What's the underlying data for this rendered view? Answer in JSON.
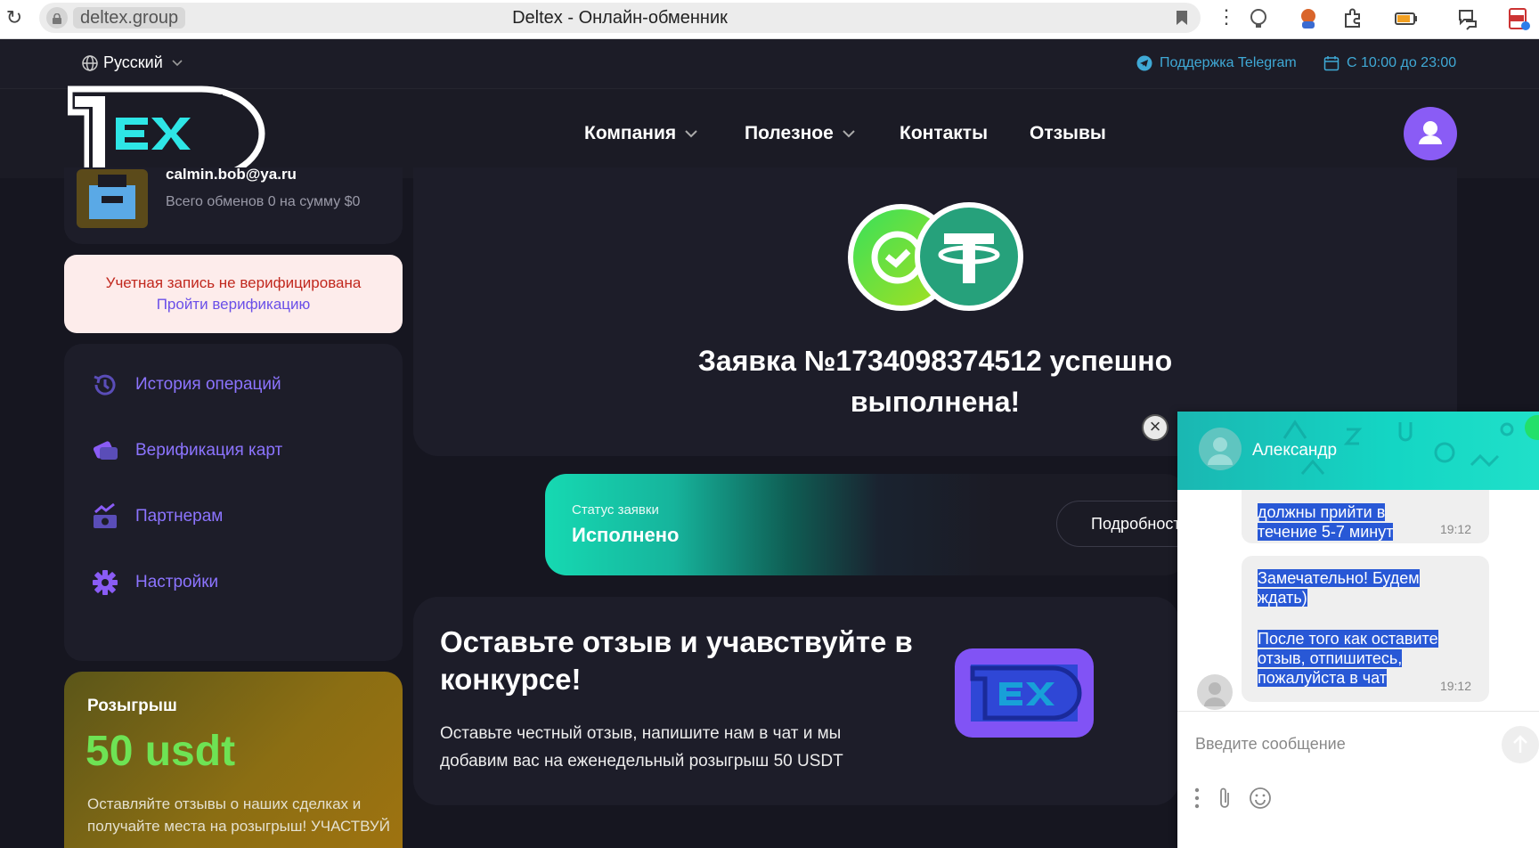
{
  "browser": {
    "url": "deltex.group",
    "tab_title": "Deltex - Онлайн-обменник"
  },
  "topbar": {
    "language": "Русский",
    "support": "Поддержка Telegram",
    "hours": "С 10:00 до 23:00"
  },
  "nav": {
    "items": [
      {
        "label": "Компания",
        "dropdown": true
      },
      {
        "label": "Полезное",
        "dropdown": true
      },
      {
        "label": "Контакты",
        "dropdown": false
      },
      {
        "label": "Отзывы",
        "dropdown": false
      }
    ]
  },
  "user": {
    "email": "calmin.bob@ya.ru",
    "stats": "Всего обменов 0 на сумму $0"
  },
  "verification": {
    "warning": "Учетная запись не верифицирована",
    "link": "Пройти верификацию"
  },
  "sidebar": {
    "items": [
      {
        "label": "История операций",
        "icon": "history-icon"
      },
      {
        "label": "Верификация карт",
        "icon": "card-icon"
      },
      {
        "label": "Партнерам",
        "icon": "partners-icon"
      },
      {
        "label": "Настройки",
        "icon": "gear-icon"
      }
    ]
  },
  "promo": {
    "title": "Розыгрыш",
    "amount": "50 usdt",
    "text": "Оставляйте отзывы о наших сделках и получайте места на розыгрыш! УЧАСТВУЙ"
  },
  "order": {
    "title": "Заявка №1734098374512 успешно выполнена!"
  },
  "status": {
    "label": "Статус заявки",
    "value": "Исполнено",
    "details_button": "Подробности"
  },
  "review": {
    "title": "Оставьте отзыв и учавствуйте в конкурсе!",
    "text": "Оставьте честный отзыв, напишите нам в чат и мы добавим вас на еженедельный розыгрыш 50 USDT"
  },
  "chat": {
    "operator_name": "Александр",
    "messages": [
      {
        "text": "должны прийти в течение 5-7 минут",
        "time": "19:12"
      },
      {
        "text_1": "Замечательно! Будем ждать)",
        "text_2": "После того как оставите отзыв, отпишитесь, пожалуйста в чат",
        "time": "19:12"
      }
    ],
    "input_placeholder": "Введите сообщение"
  },
  "colors": {
    "accent_purple": "#8a5cf5",
    "menu_text": "#8c74ff",
    "success_teal": "#16d9b2",
    "promo_green": "#6ee354",
    "warning_red": "#c1281e",
    "link_blue": "#3fa9d6"
  }
}
